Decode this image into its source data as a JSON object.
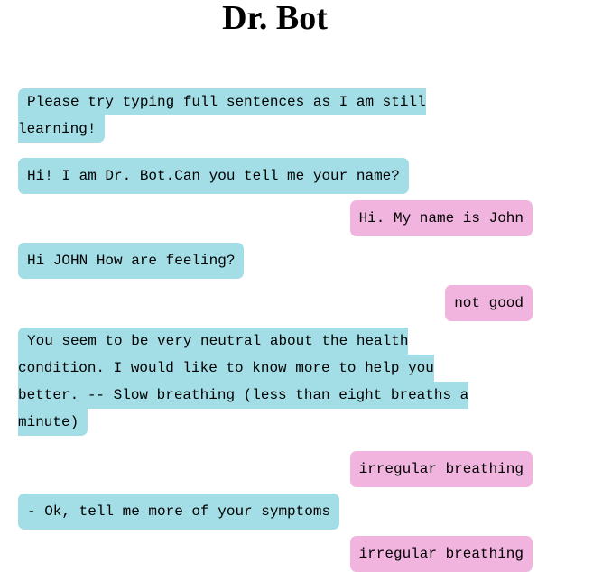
{
  "page": {
    "title": "Dr. Bot"
  },
  "colors": {
    "bot_bubble": "#a3dde6",
    "user_bubble": "#f1b4df"
  },
  "messages": [
    {
      "sender": "bot",
      "lines": [
        " Please try typing full sentences as I am still",
        "learning!"
      ]
    },
    {
      "sender": "bot",
      "text": "Hi! I am Dr. Bot.Can you tell me your name?"
    },
    {
      "sender": "user",
      "text": "Hi. My name is John"
    },
    {
      "sender": "bot",
      "text": "Hi JOHN How are feeling?"
    },
    {
      "sender": "user",
      "text": "not good"
    },
    {
      "sender": "bot",
      "lines": [
        " You seem to be very neutral about the health",
        "condition. I would like to know more to help you",
        "better. -- Slow breathing (less than eight breaths a",
        "minute)"
      ]
    },
    {
      "sender": "user",
      "text": "irregular breathing"
    },
    {
      "sender": "bot",
      "text": "- Ok, tell me more of your symptoms"
    },
    {
      "sender": "user",
      "text": "irregular breathing"
    }
  ]
}
